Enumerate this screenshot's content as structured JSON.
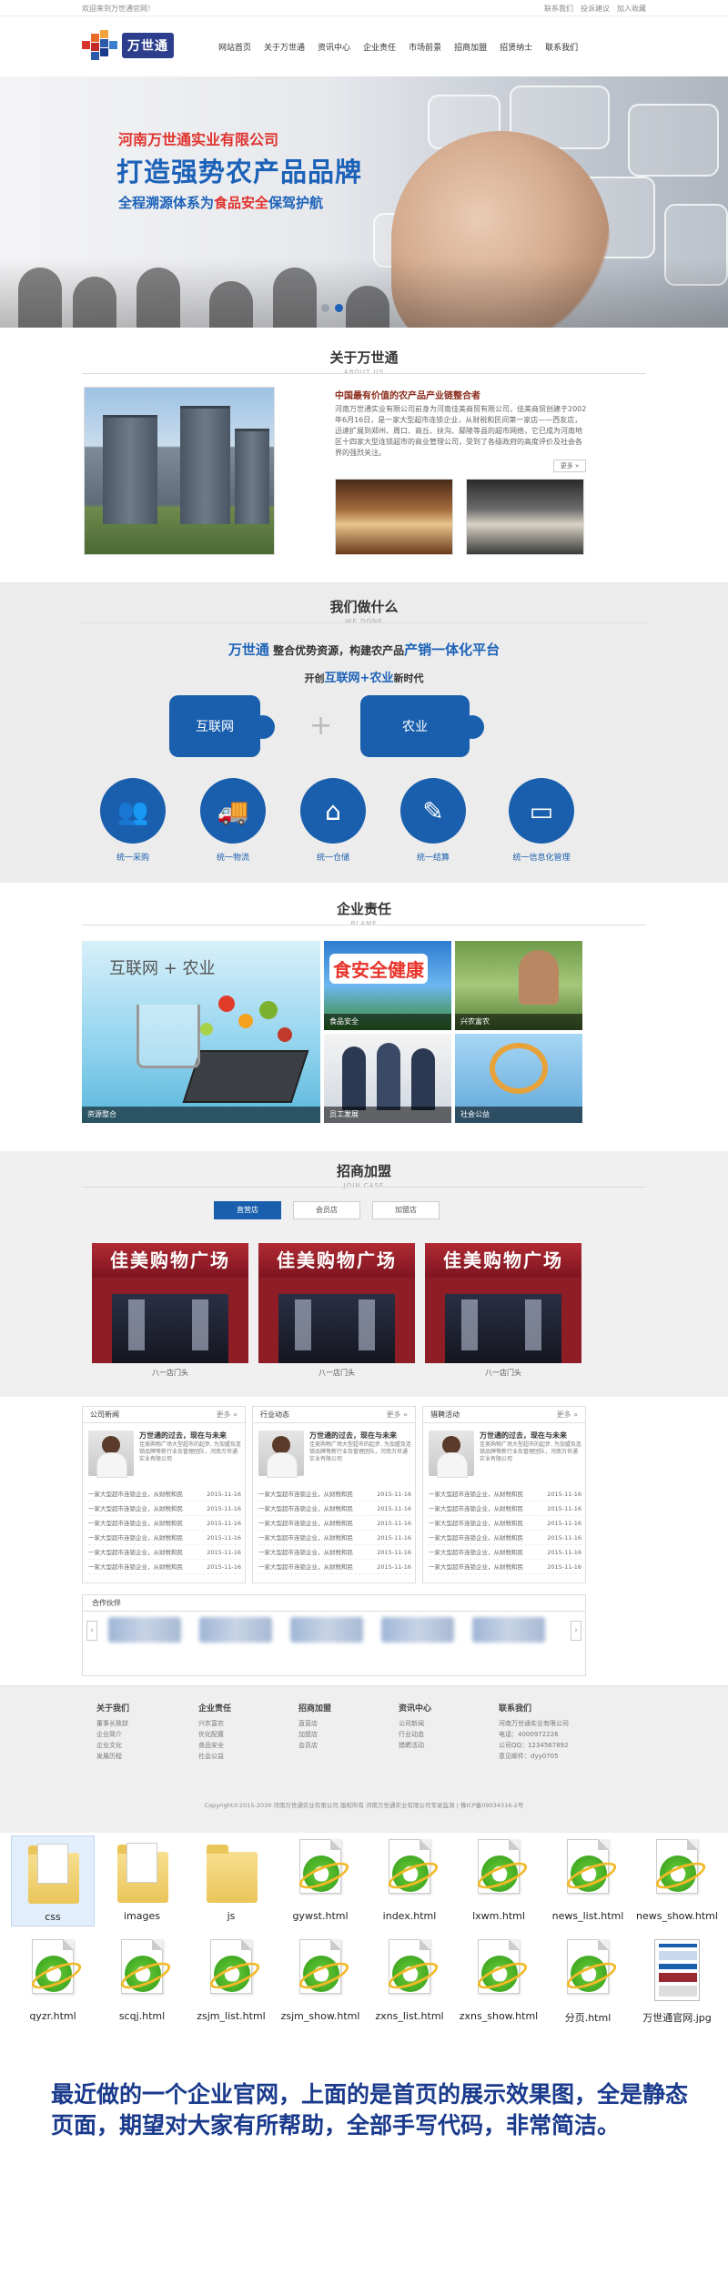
{
  "topbar": {
    "welcome": "欢迎来到万世通官网！",
    "links": [
      "联系我们",
      "投诉建议",
      "加入收藏"
    ]
  },
  "header": {
    "logo_text": "万世通",
    "nav": [
      "网站首页",
      "关于万世通",
      "资讯中心",
      "企业责任",
      "市场前景",
      "招商加盟",
      "招贤纳士",
      "联系我们"
    ]
  },
  "banner": {
    "company": "河南万世通实业有限公司",
    "slogan": "打造强势农产品品牌",
    "sub_prefix": "全程溯源体系为",
    "sub_highlight": "食品安全",
    "sub_suffix": "保驾护航"
  },
  "about": {
    "title": "关于万世通",
    "title_en": "ABOUT US",
    "headline": "中国最有价值的农产品产业链整合者",
    "text": "河南万世通实业有限公司前身为河南佳美商贸有限公司，佳美商贸创建于2002年6月16日，是一家大型超市连锁企业，从财税和民间第一家店——西友店，迅速扩展到郑州、周口、商丘、扶沟、鄢陵等县的超市网络，它已成为河南地区十四家大型连锁超市的商业管理公司，受到了各级政府的高度评价及社会各界的强烈关注。",
    "more": "更多 »"
  },
  "wedo": {
    "title": "我们做什么",
    "title_en": "WE DONE",
    "line1_brand": "万世通",
    "line1_mid": "整合优势资源，构建农产品",
    "line1_hl": "产销一体化平台",
    "line2_pre": "开创",
    "line2_hl": "互联网+农业",
    "line2_suf": "新时代",
    "puzzle_left": "互联网",
    "puzzle_right": "农业",
    "plus": "+",
    "items": [
      "统一采购",
      "统一物流",
      "统一仓储",
      "统一结算",
      "统一信息化管理"
    ]
  },
  "duty": {
    "title": "企业责任",
    "title_en": "BLAME",
    "big_header": "互联网 + 农业",
    "big_caption": "资源整合",
    "safety_word": "食安全健康",
    "captions": [
      "食品安全",
      "兴农富农",
      "员工发展",
      "社会公益"
    ]
  },
  "join": {
    "title": "招商加盟",
    "title_en": "JOIN CASE",
    "tabs": [
      "直营店",
      "会员店",
      "加盟店"
    ],
    "store_sign": "佳美购物广场",
    "stores": [
      "八一店门头",
      "八一店门头",
      "八一店门头"
    ]
  },
  "news": {
    "more": "更多 »",
    "panels": [
      {
        "title": "公司新闻",
        "headline": "万世通的过去，现在与未来",
        "desc": "佳美购物广场大型超市的起步, 为加盟及连锁品牌等新行业及管理团队，河南万世通实业有限公司"
      },
      {
        "title": "行业动态",
        "headline": "万世通的过去，现在与未来",
        "desc": "佳美购物广场大型超市的起步, 为加盟及连锁品牌等新行业及管理团队，河南万世通实业有限公司"
      },
      {
        "title": "猎聘活动",
        "headline": "万世通的过去，现在与未来",
        "desc": "佳美购物广场大型超市的起步, 为加盟及连锁品牌等新行业及管理团队，河南万世通实业有限公司"
      }
    ],
    "item_text": "一家大型超市连锁企业，从财税和民",
    "item_date": "2015-11-16"
  },
  "partners": {
    "title": "合作伙伴",
    "prev": "‹",
    "next": "›"
  },
  "footer": {
    "cols": [
      {
        "title": "关于我们",
        "items": [
          "董事长致辞",
          "企业简介",
          "企业文化",
          "发展历程"
        ]
      },
      {
        "title": "企业责任",
        "items": [
          "兴农富农",
          "优化配置",
          "食品安全",
          "社会公益"
        ]
      },
      {
        "title": "招商加盟",
        "items": [
          "直营店",
          "加盟店",
          "会员店"
        ]
      },
      {
        "title": "资讯中心",
        "items": [
          "公司新闻",
          "行业动态",
          "猎聘活动"
        ]
      },
      {
        "title": "联系我们",
        "items": [
          "河南万世通实业有限公司",
          "电话：4000972226",
          "公司QQ：1234567892",
          "意见邮件：dyy0705"
        ]
      }
    ],
    "copyright": "Copyright©2015-2030 河南万世通实业有限公司 版权所有 河南万世通实业有限公司专家监测 | 豫ICP备09034316-2号"
  },
  "files": [
    {
      "name": "css",
      "type": "folder"
    },
    {
      "name": "images",
      "type": "folder"
    },
    {
      "name": "js",
      "type": "folder"
    },
    {
      "name": "gywst.html",
      "type": "html"
    },
    {
      "name": "index.html",
      "type": "html"
    },
    {
      "name": "lxwm.html",
      "type": "html"
    },
    {
      "name": "news_list.html",
      "type": "html"
    },
    {
      "name": "news_show.html",
      "type": "html"
    },
    {
      "name": "qyzr.html",
      "type": "html"
    },
    {
      "name": "scqj.html",
      "type": "html"
    },
    {
      "name": "zsjm_list.html",
      "type": "html"
    },
    {
      "name": "zsjm_show.html",
      "type": "html"
    },
    {
      "name": "zxns_list.html",
      "type": "html"
    },
    {
      "name": "zxns_show.html",
      "type": "html"
    },
    {
      "name": "分页.html",
      "type": "html"
    },
    {
      "name": "万世通官网.jpg",
      "type": "image"
    }
  ],
  "caption_text": "最近做的一个企业官网，上面的是首页的展示效果图，全是静态页面，期望对大家有所帮助，全部手写代码，非常简洁。"
}
